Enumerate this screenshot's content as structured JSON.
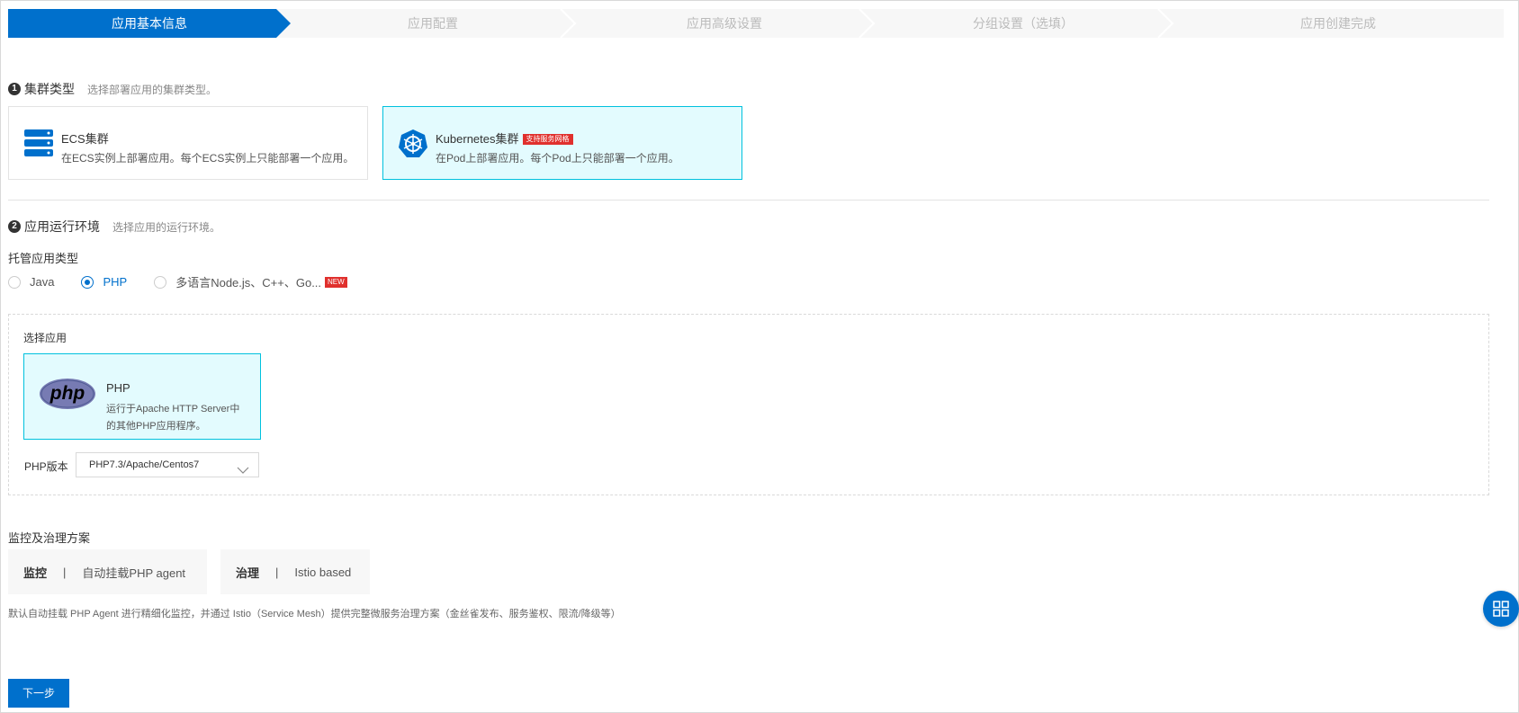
{
  "steps": [
    {
      "label": "应用基本信息",
      "active": true
    },
    {
      "label": "应用配置",
      "active": false
    },
    {
      "label": "应用高级设置",
      "active": false
    },
    {
      "label": "分组设置（选填）",
      "active": false
    },
    {
      "label": "应用创建完成",
      "active": false
    }
  ],
  "colors": {
    "primary": "#0070cc",
    "selected_border": "#00c1de",
    "selected_bg": "#e3fbfe",
    "badge_red": "#e0302d"
  },
  "cluster": {
    "number": "1",
    "title": "集群类型",
    "hint": "选择部署应用的集群类型。",
    "options": [
      {
        "title": "ECS集群",
        "desc": "在ECS实例上部署应用。每个ECS实例上只能部署一个应用。",
        "icon": "server-icon",
        "selected": false
      },
      {
        "title": "Kubernetes集群",
        "badge": "支持服务网格",
        "desc": "在Pod上部署应用。每个Pod上只能部署一个应用。",
        "icon": "kubernetes-icon",
        "selected": true
      }
    ]
  },
  "runtime": {
    "number": "2",
    "title": "应用运行环境",
    "hint": "选择应用的运行环境。",
    "type_label": "托管应用类型",
    "types": [
      {
        "label": "Java",
        "checked": false
      },
      {
        "label": "PHP",
        "checked": true
      },
      {
        "label": "多语言Node.js、C++、Go...",
        "checked": false,
        "badge": "NEW"
      }
    ],
    "select_app_label": "选择应用",
    "app": {
      "logo_text": "php",
      "title": "PHP",
      "desc_line1": "运行于Apache HTTP Server中",
      "desc_line2": "的其他PHP应用程序。"
    },
    "version_label": "PHP版本",
    "version_value": "PHP7.3/Apache/Centos7"
  },
  "governance": {
    "title": "监控及治理方案",
    "monitor": {
      "name": "监控",
      "sep": "|",
      "value": "自动挂载PHP agent"
    },
    "govern": {
      "name": "治理",
      "sep": "|",
      "value": "Istio based"
    },
    "footnote": "默认自动挂载 PHP Agent 进行精细化监控，并通过 Istio（Service Mesh）提供完整微服务治理方案（金丝雀发布、服务鉴权、限流/降级等）"
  },
  "next_label": "下一步"
}
